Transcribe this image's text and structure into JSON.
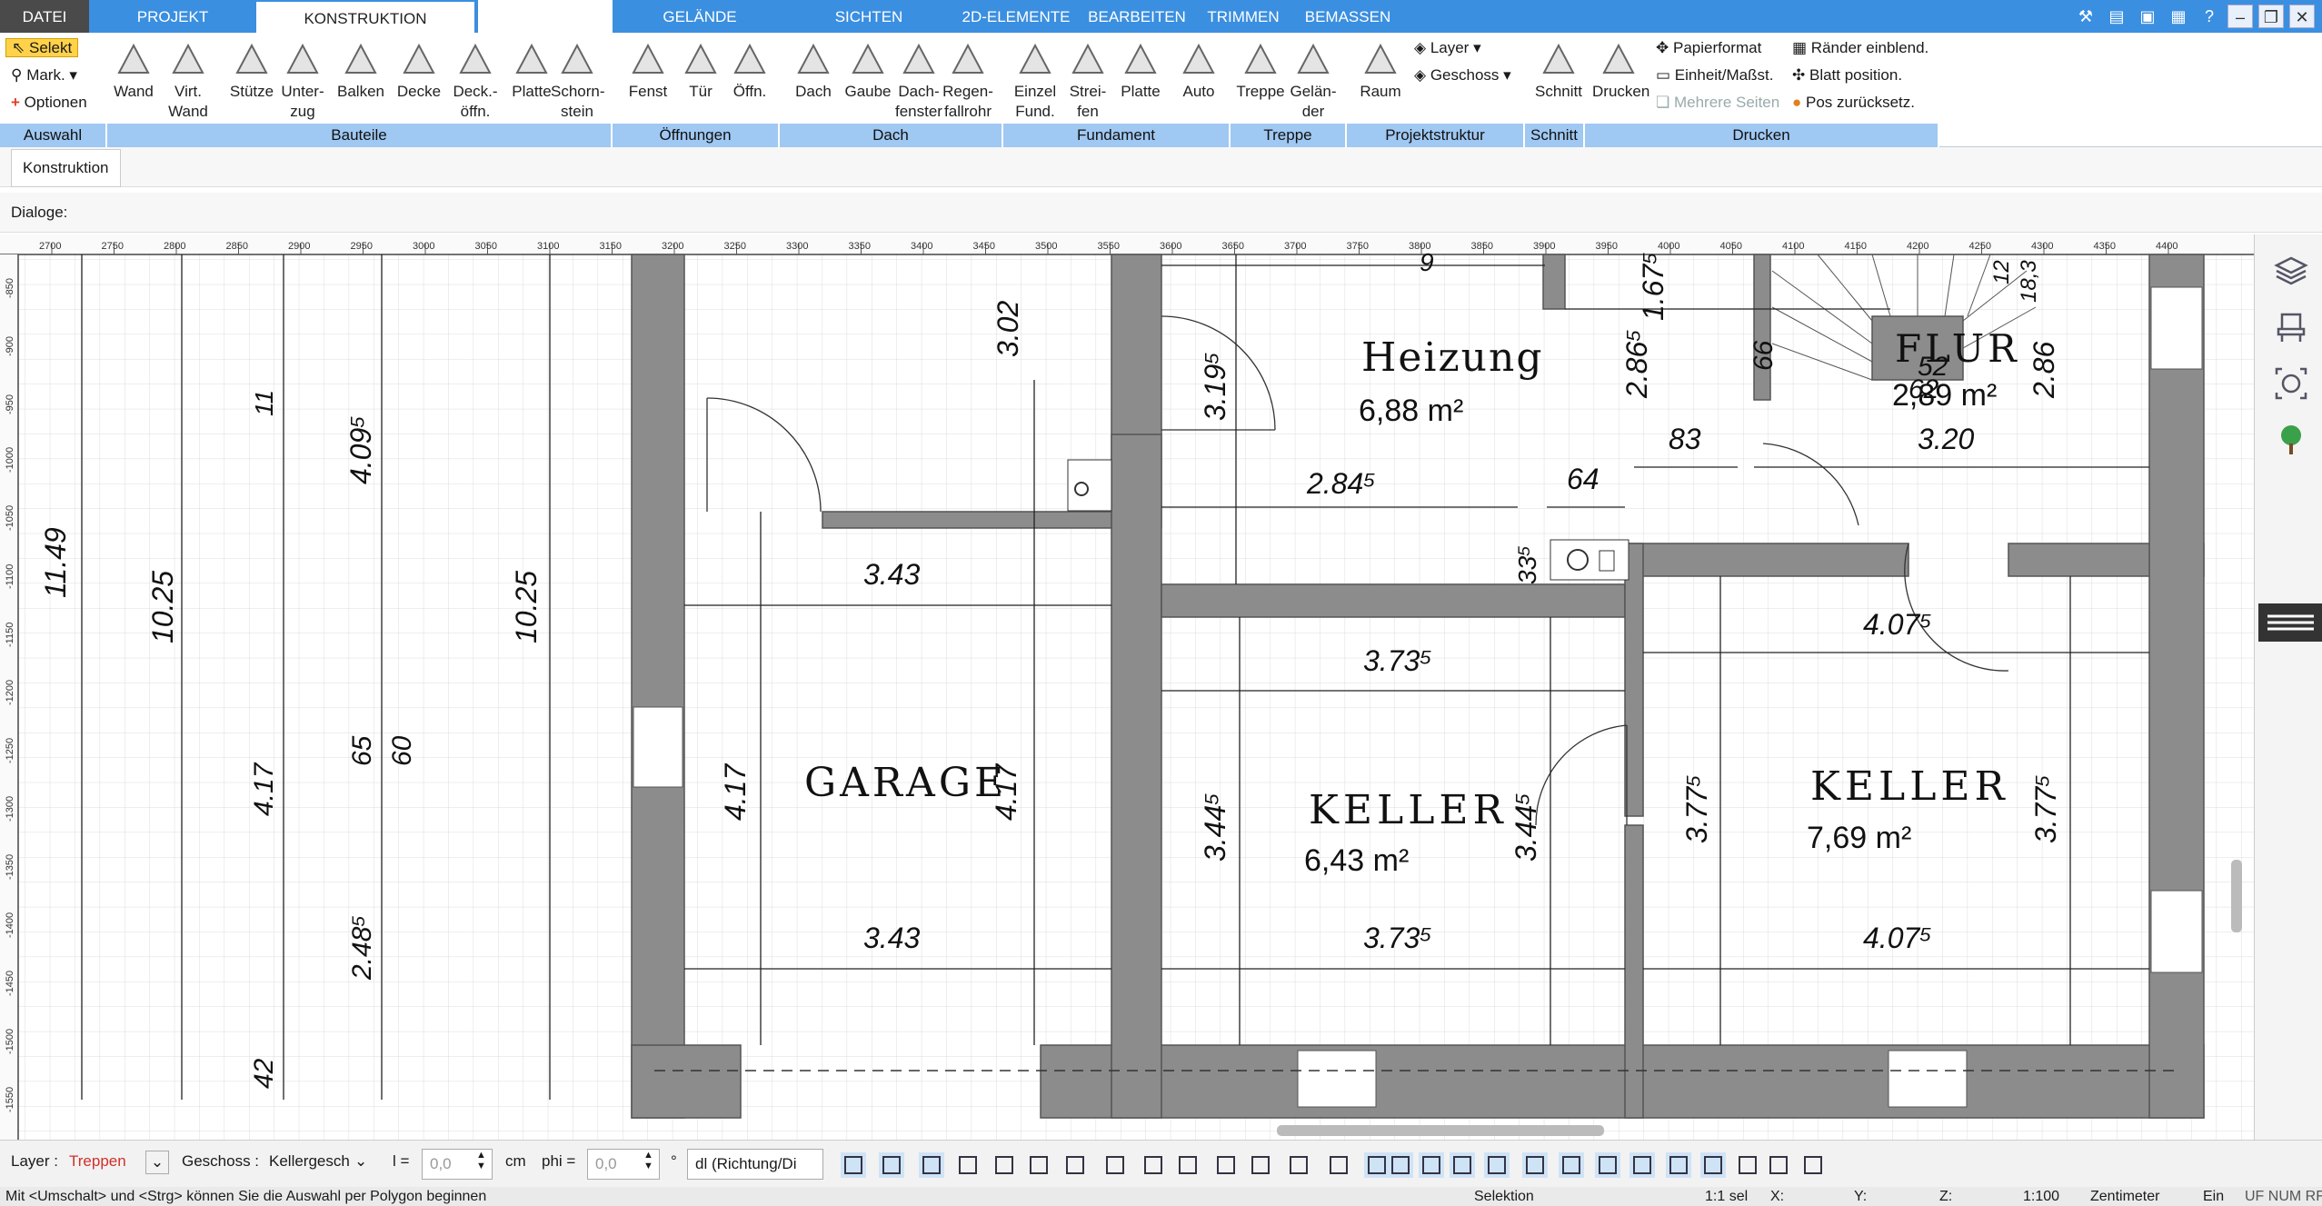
{
  "tabs": [
    {
      "label": "DATEI"
    },
    {
      "label": "PROJEKT"
    },
    {
      "label": "KONSTRUKTION"
    },
    {
      "label": ""
    },
    {
      "label": "GELÄNDE"
    },
    {
      "label": "SICHTEN"
    },
    {
      "label": "2D-ELEMENTE"
    },
    {
      "label": "BEARBEITEN"
    },
    {
      "label": "TRIMMEN"
    },
    {
      "label": "BEMASSEN"
    }
  ],
  "ribbon": {
    "selekt": "Selekt",
    "mark": "Mark.",
    "optionen": "Optionen",
    "buttons": [
      {
        "l1": "Wand",
        "l2": ""
      },
      {
        "l1": "Virt.",
        "l2": "Wand"
      },
      {
        "l1": "Stütze",
        "l2": ""
      },
      {
        "l1": "Unter-",
        "l2": "zug"
      },
      {
        "l1": "Balken",
        "l2": ""
      },
      {
        "l1": "Decke",
        "l2": ""
      },
      {
        "l1": "Deck.-",
        "l2": "öffn."
      },
      {
        "l1": "Platte",
        "l2": ""
      },
      {
        "l1": "Schorn-",
        "l2": "stein"
      },
      {
        "l1": "Fenst",
        "l2": ""
      },
      {
        "l1": "Tür",
        "l2": ""
      },
      {
        "l1": "Öffn.",
        "l2": ""
      },
      {
        "l1": "Dach",
        "l2": ""
      },
      {
        "l1": "Gaube",
        "l2": ""
      },
      {
        "l1": "Dach-",
        "l2": "fenster"
      },
      {
        "l1": "Regen-",
        "l2": "fallrohr"
      },
      {
        "l1": "Einzel",
        "l2": "Fund."
      },
      {
        "l1": "Strei-",
        "l2": "fen"
      },
      {
        "l1": "Platte",
        "l2": ""
      },
      {
        "l1": "Auto",
        "l2": ""
      },
      {
        "l1": "Treppe",
        "l2": ""
      },
      {
        "l1": "Gelän-",
        "l2": "der"
      },
      {
        "l1": "Raum",
        "l2": ""
      },
      {
        "l1": "Schnitt",
        "l2": ""
      },
      {
        "l1": "Drucken",
        "l2": ""
      }
    ],
    "layer": "Layer",
    "geschoss": "Geschoss",
    "papierformat": "Papierformat",
    "einheit": "Einheit/Maßst.",
    "mehrere_seiten": "Mehrere Seiten",
    "raender": "Ränder einblend.",
    "blatt": "Blatt position.",
    "pos_zurueck": "Pos zurücksetz.",
    "groups": [
      "Auswahl",
      "Bauteile",
      "Öffnungen",
      "Dach",
      "Fundament",
      "Treppe",
      "Projektstruktur",
      "Schnitt",
      "Drucken"
    ]
  },
  "subtab": "Konstruktion",
  "dialoge": "Dialoge:",
  "ruler_labels": [
    "2700",
    "2750",
    "2800",
    "2850",
    "2900",
    "2950",
    "3000",
    "3050",
    "3100",
    "3150",
    "3200",
    "3250",
    "3300",
    "3350",
    "3400",
    "3450",
    "3500",
    "3550",
    "3600",
    "3650",
    "3700",
    "3750",
    "3800",
    "3850",
    "3900",
    "3950",
    "4000",
    "4050",
    "4100",
    "4150",
    "4200",
    "4250",
    "4300",
    "4350",
    "4400"
  ],
  "vruler_labels": [
    "-850",
    "-900",
    "-950",
    "-1000",
    "-1050",
    "-1100",
    "-1150",
    "-1200",
    "-1250",
    "-1300",
    "-1350",
    "-1400",
    "-1450",
    "-1500",
    "-1550"
  ],
  "rooms": {
    "heizung": {
      "name": "Heizung",
      "area": "6,88 m²"
    },
    "flur": {
      "name": "FLUR",
      "area": "2,89 m²"
    },
    "garage": {
      "name": "GARAGE"
    },
    "keller1": {
      "name": "KELLER",
      "area": "6,43 m²"
    },
    "keller2": {
      "name": "KELLER",
      "area": "7,69 m²"
    }
  },
  "dims": {
    "d1149": "11.49",
    "d1025a": "10.25",
    "d11": "11",
    "d409": "4.09⁵",
    "d1025b": "10.25",
    "d417a": "4.17",
    "d65": "65",
    "d60": "60",
    "d248": "2.48⁵",
    "d42": "42",
    "d302": "3.02",
    "d319": "3.19⁵",
    "d343a": "3.43",
    "d417b": "4.17",
    "d417c": "4.17",
    "d343b": "3.43",
    "d284": "2.84⁵",
    "d64": "64",
    "d335": "33⁵",
    "d286": "2.86⁵",
    "d167": "1.67⁵",
    "d66": "66",
    "d83": "83",
    "d62": "62",
    "d52": "52",
    "d12": "12",
    "d183": "18,3",
    "d286b": "2.86",
    "d320": "3.20",
    "d9": "9",
    "d373a": "3.73⁵",
    "d344a": "3.44⁵",
    "d344b": "3.44⁵",
    "d373b": "3.73⁵",
    "d407a": "4.07⁵",
    "d377a": "3.77⁵",
    "d377b": "3.77⁵",
    "d407b": "4.07⁵"
  },
  "options": {
    "layer_label": "Layer :",
    "layer_value": "Treppen",
    "geschoss_label": "Geschoss :",
    "geschoss_value": "Kellergesch",
    "l_label": "l =",
    "l_value": "0,0",
    "cm": "cm",
    "phi_label": "phi =",
    "phi_value": "0,0",
    "deg": "°",
    "dl": "dl (Richtung/Di",
    "accent_red": "#d0302a"
  },
  "status": {
    "hint": "Mit <Umschalt> und <Strg> können Sie die Auswahl per Polygon beginnen",
    "mode": "Selektion",
    "sel": "1:1 sel",
    "x": "X:",
    "y": "Y:",
    "z": "Z:",
    "scale": "1:100",
    "unit": "Zentimeter",
    "ein": "Ein",
    "flags": "UF NUM RF"
  },
  "colors": {
    "tabbar": "#3b8fe0",
    "group_bar": "#9fc8f2",
    "wall": "#8c8c8c"
  }
}
